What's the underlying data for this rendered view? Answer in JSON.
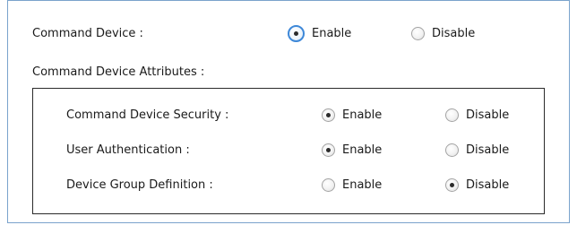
{
  "command_device": {
    "label": "Command Device :",
    "enable_label": "Enable",
    "disable_label": "Disable",
    "selected": "Enable"
  },
  "attributes": {
    "title": "Command Device Attributes :",
    "rows": [
      {
        "label": "Command Device Security :",
        "enable_label": "Enable",
        "disable_label": "Disable",
        "selected": "Enable"
      },
      {
        "label": "User Authentication :",
        "enable_label": "Enable",
        "disable_label": "Disable",
        "selected": "Enable"
      },
      {
        "label": "Device Group Definition :",
        "enable_label": "Enable",
        "disable_label": "Disable",
        "selected": "Disable"
      }
    ]
  },
  "colors": {
    "frame_border": "#7aa3cc",
    "focus_ring": "#3e88d8",
    "box_border": "#2a2a2a"
  }
}
